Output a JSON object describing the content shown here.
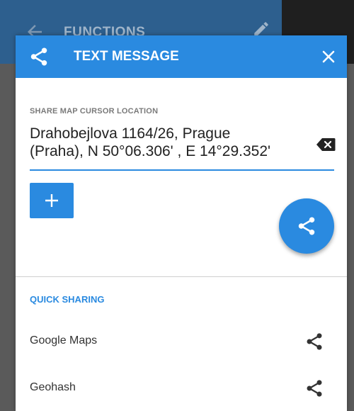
{
  "background": {
    "title": "FUNCTIONS",
    "back_icon": "arrow-back-icon",
    "edit_icon": "pencil-icon"
  },
  "dialog": {
    "title": "TEXT MESSAGE",
    "header_icon": "share-icon",
    "close_icon": "close-icon",
    "accent_color": "#2a8ae0",
    "field": {
      "label": "SHARE MAP CURSOR LOCATION",
      "value_line1": "Drahobejlova 1164/26, Prague",
      "value_line2": "(Praha), N 50°06.306' , E 14°29.352'",
      "clear_icon": "backspace-icon"
    },
    "add_button_icon": "plus-icon",
    "share_fab_icon": "share-icon",
    "quick_sharing": {
      "title": "QUICK SHARING",
      "items": [
        {
          "label": "Google Maps",
          "icon": "share-icon"
        },
        {
          "label": "Geohash",
          "icon": "share-icon"
        }
      ]
    }
  }
}
